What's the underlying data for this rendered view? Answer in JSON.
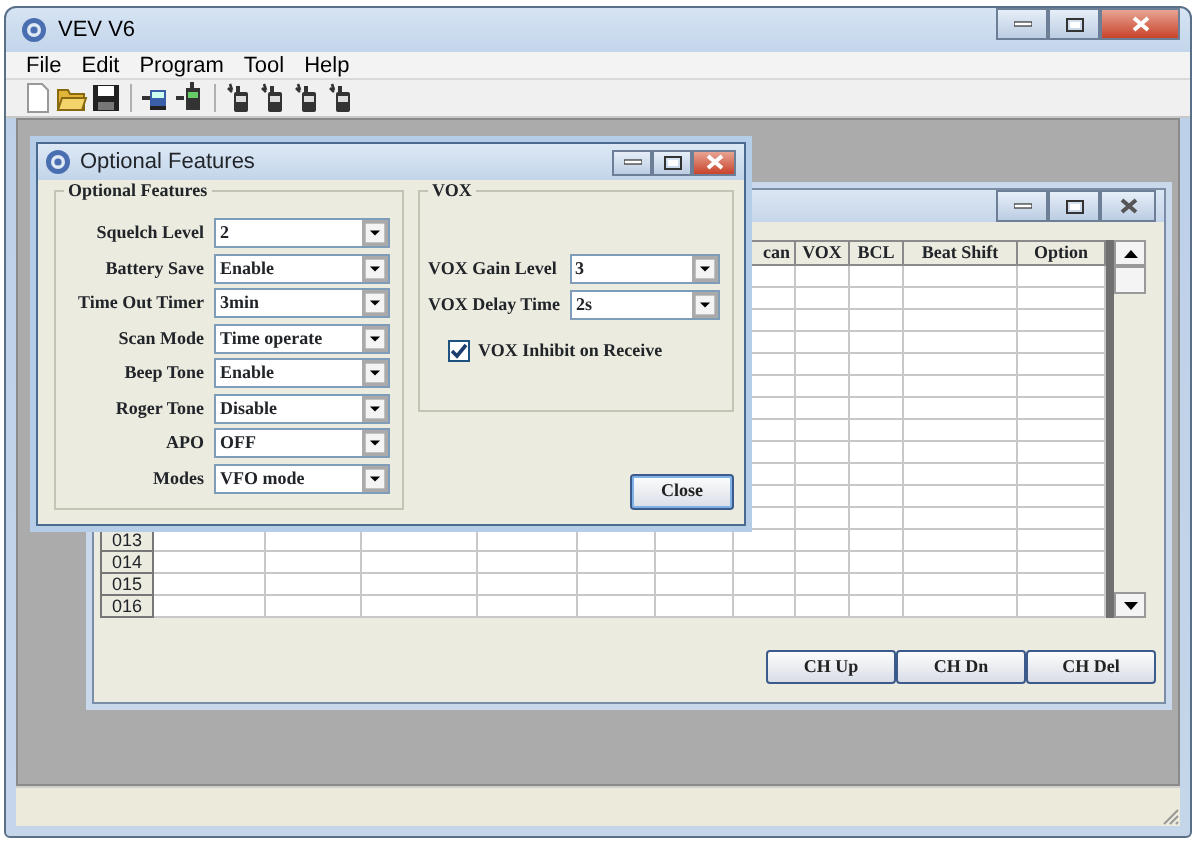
{
  "main_window": {
    "title": "VEV V6",
    "menu": [
      "File",
      "Edit",
      "Program",
      "Tool",
      "Help"
    ]
  },
  "channel_window": {
    "columns": [
      "can",
      "VOX",
      "BCL",
      "Beat Shift",
      "Option"
    ],
    "rows": [
      "013",
      "014",
      "015",
      "016"
    ],
    "buttons": [
      {
        "label": "CH Up"
      },
      {
        "label": "CH Dn"
      },
      {
        "label": "CH Del"
      }
    ]
  },
  "dialog": {
    "title": "Optional Features",
    "groups": [
      {
        "title": "Optional Features",
        "fields": [
          {
            "label": "Squelch Level",
            "value": "2"
          },
          {
            "label": "Battery Save",
            "value": "Enable"
          },
          {
            "label": "Time Out Timer",
            "value": "3min"
          },
          {
            "label": "Scan Mode",
            "value": "Time operate"
          },
          {
            "label": "Beep Tone",
            "value": "Enable"
          },
          {
            "label": "Roger Tone",
            "value": "Disable"
          },
          {
            "label": "APO",
            "value": "OFF"
          },
          {
            "label": "Modes",
            "value": "VFO mode"
          }
        ]
      },
      {
        "title": "VOX",
        "fields": [
          {
            "label": "VOX Gain Level",
            "value": "3"
          },
          {
            "label": "VOX Delay Time",
            "value": "2s"
          }
        ],
        "checkbox": {
          "label": "VOX Inhibit on Receive",
          "checked": true
        }
      }
    ],
    "close_button": {
      "label": "Close"
    }
  }
}
